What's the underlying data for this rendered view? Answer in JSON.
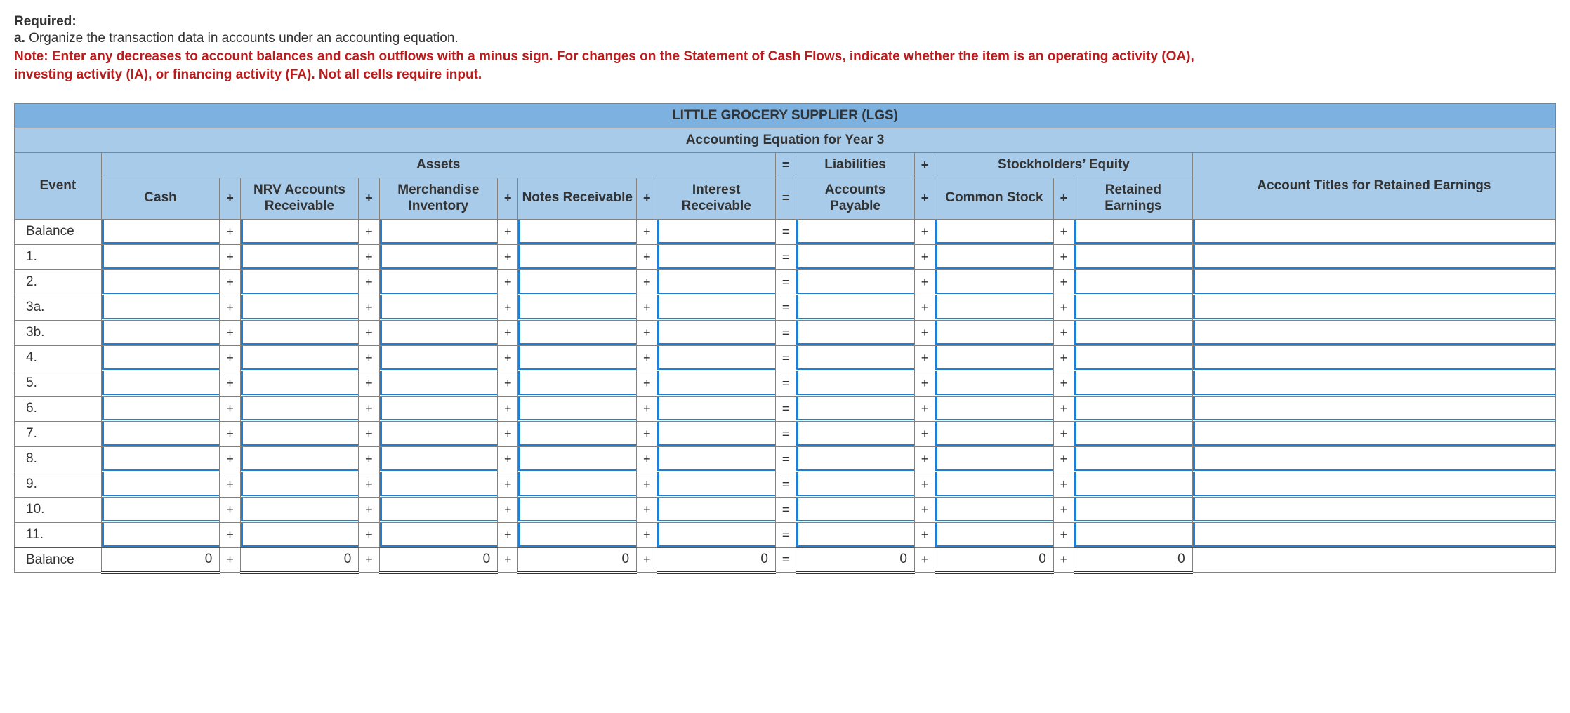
{
  "header": {
    "required": "Required:",
    "item_a_prefix": "a.",
    "item_a_text": " Organize the transaction data in accounts under an accounting equation.",
    "note": "Note: Enter any decreases to account balances and cash outflows with a minus sign. For changes on the Statement of Cash Flows, indicate whether the item is an operating activity (OA), investing activity (IA), or financing activity (FA). Not all cells require input."
  },
  "table": {
    "title1": "LITTLE GROCERY SUPPLIER (LGS)",
    "title2": "Accounting Equation for Year 3",
    "groups": {
      "assets": "Assets",
      "liabilities": "Liabilities",
      "equity": "Stockholders’ Equity"
    },
    "cols": {
      "event": "Event",
      "cash": "Cash",
      "nrv": "NRV Accounts Receivable",
      "merch": "Merchandise Inventory",
      "notes": "Notes Receivable",
      "interest": "Interest Receivable",
      "ap": "Accounts Payable",
      "cs": "Common Stock",
      "re": "Retained Earnings",
      "titles": "Account Titles for Retained Earnings"
    },
    "ops": {
      "plus": "+",
      "eq": "="
    },
    "rows": [
      {
        "label": "Balance",
        "type": "input"
      },
      {
        "label": "1.",
        "type": "input"
      },
      {
        "label": "2.",
        "type": "input"
      },
      {
        "label": "3a.",
        "type": "input"
      },
      {
        "label": "3b.",
        "type": "input"
      },
      {
        "label": "4.",
        "type": "input"
      },
      {
        "label": "5.",
        "type": "input"
      },
      {
        "label": "6.",
        "type": "input"
      },
      {
        "label": "7.",
        "type": "input"
      },
      {
        "label": "8.",
        "type": "input"
      },
      {
        "label": "9.",
        "type": "input"
      },
      {
        "label": "10.",
        "type": "input"
      },
      {
        "label": "11.",
        "type": "input"
      }
    ],
    "balance_row": {
      "label": "Balance",
      "vals": {
        "cash": "0",
        "nrv": "0",
        "merch": "0",
        "notes": "0",
        "interest": "0",
        "ap": "0",
        "cs": "0",
        "re": "0"
      }
    }
  }
}
